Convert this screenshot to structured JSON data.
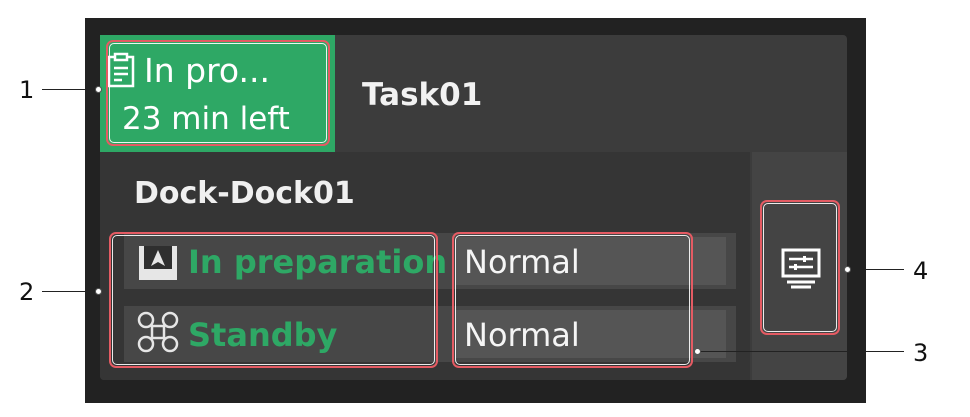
{
  "task": {
    "status": "In pro...",
    "time_left": "23 min left",
    "name": "Task01"
  },
  "dock": {
    "title": "Dock-Dock01",
    "rows": [
      {
        "status": "In preparation",
        "value": "Normal",
        "icon": "dock-icon"
      },
      {
        "status": "Standby",
        "value": "Normal",
        "icon": "drone-icon"
      }
    ]
  },
  "side_button": {
    "icon": "task-panel-icon"
  },
  "callouts": [
    "1",
    "2",
    "3",
    "4"
  ],
  "colors": {
    "accent": "#2ea865",
    "highlight": "#e45b63",
    "background": "#222222"
  }
}
